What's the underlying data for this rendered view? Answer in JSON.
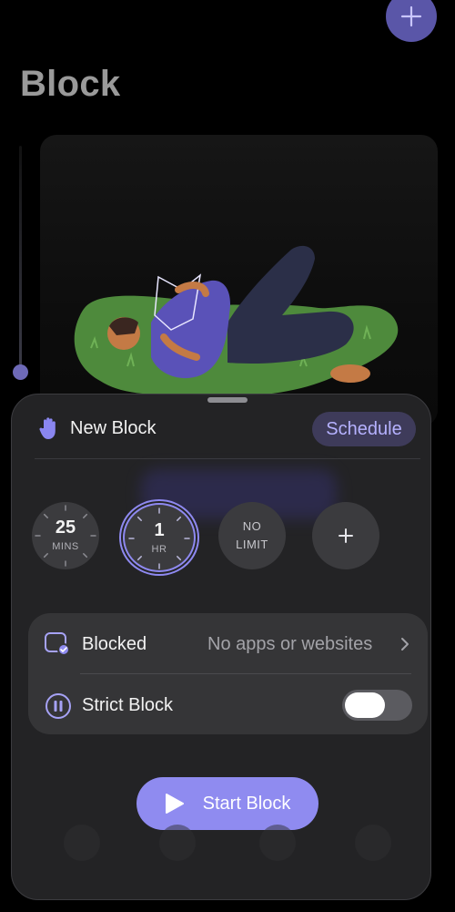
{
  "header": {
    "title": "Block"
  },
  "sheet": {
    "title": "New Block",
    "schedule_label": "Schedule"
  },
  "durations": [
    {
      "value": "25",
      "unit": "MINS",
      "selected": false
    },
    {
      "value": "1",
      "unit": "HR",
      "selected": true
    },
    {
      "line1": "NO",
      "line2": "LIMIT",
      "selected": false
    },
    {
      "symbol": "+"
    }
  ],
  "settings": {
    "blocked_label": "Blocked",
    "blocked_value": "No apps or websites",
    "strict_label": "Strict Block",
    "strict_enabled": false
  },
  "start_button": {
    "label": "Start Block"
  },
  "colors": {
    "accent": "#8f8bf0",
    "accent_text": "#b6b2ff",
    "sheet_bg": "#242426",
    "card_bg": "#353537"
  },
  "icons": [
    "plus-icon",
    "hand-icon",
    "blocked-apps-icon",
    "pause-circle-icon",
    "chevron-right-icon",
    "play-icon"
  ]
}
